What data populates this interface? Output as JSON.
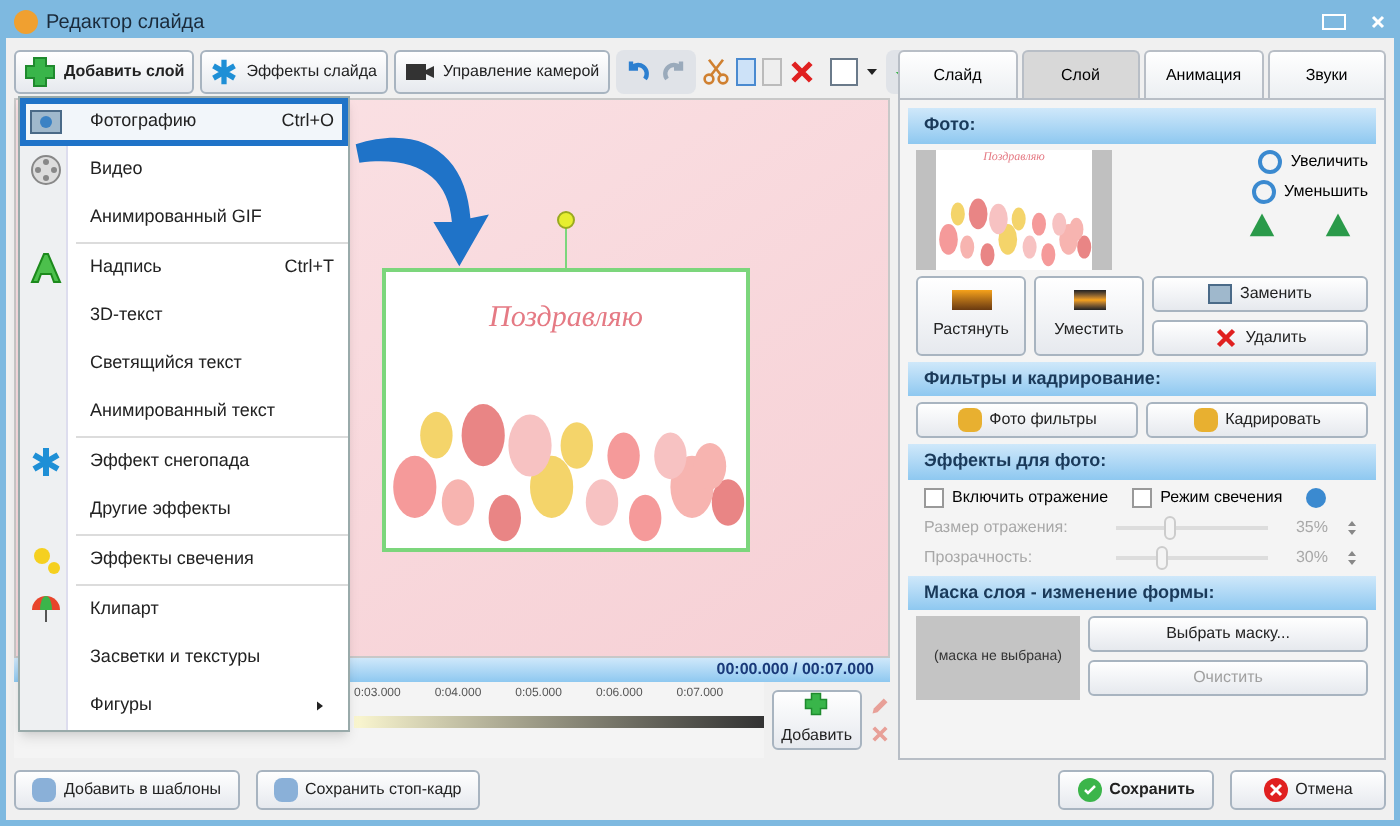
{
  "window": {
    "title": "Редактор слайда"
  },
  "toolbar": {
    "buttons": [
      {
        "label": "Добавить слой",
        "kind": "add"
      },
      {
        "label": "Эффекты слайда",
        "kind": "effects"
      },
      {
        "label": "Управление камерой",
        "kind": "camera"
      }
    ]
  },
  "menu": {
    "sections": [
      [
        {
          "label": "Фотографию",
          "shortcut": "Ctrl+O",
          "selected": true,
          "kind": "photo"
        },
        {
          "label": "Видео",
          "selected": false,
          "kind": "video"
        },
        {
          "label": "Анимированный GIF",
          "selected": false,
          "kind": "none"
        }
      ],
      [
        {
          "label": "Надпись",
          "shortcut": "Ctrl+T",
          "selected": false,
          "kind": "text"
        },
        {
          "label": "3D-текст",
          "selected": false,
          "kind": "none"
        },
        {
          "label": "Светящийся текст",
          "selected": false,
          "kind": "none"
        },
        {
          "label": "Анимированный текст",
          "selected": false,
          "kind": "none"
        }
      ],
      [
        {
          "label": "Эффект снегопада",
          "selected": false,
          "kind": "snow"
        },
        {
          "label": "Другие эффекты",
          "selected": false,
          "kind": "none"
        }
      ],
      [
        {
          "label": "Эффекты свечения",
          "selected": false,
          "kind": "glow"
        }
      ],
      [
        {
          "label": "Клипарт",
          "selected": false,
          "kind": "clipart"
        },
        {
          "label": "Засветки и текстуры",
          "selected": false,
          "kind": "none"
        },
        {
          "label": "Фигуры",
          "selected": false,
          "kind": "none",
          "submenu": true
        }
      ]
    ]
  },
  "slide": {
    "caption": "Поздравляю"
  },
  "timeline": {
    "time": "00:00.000 / 00:07.000",
    "ticks": [
      "0:03.000",
      "0:04.000",
      "0:05.000",
      "0:06.000",
      "0:07.000"
    ],
    "add_button": "Добавить"
  },
  "tabs": [
    {
      "label": "Слайд",
      "selected": false
    },
    {
      "label": "Слой",
      "selected": true
    },
    {
      "label": "Анимация",
      "selected": false
    },
    {
      "label": "Звуки",
      "selected": false
    }
  ],
  "photo": {
    "heading": "Фото:",
    "caption": "Поздравляю",
    "zoom_in": "Увеличить",
    "zoom_out": "Уменьшить",
    "stretch": "Растянуть",
    "fit": "Уместить",
    "replace": "Заменить",
    "delete": "Удалить"
  },
  "filters": {
    "heading": "Фильтры и кадрирование:",
    "buttons": [
      "Фото фильтры",
      "Кадрировать"
    ]
  },
  "effects": {
    "heading": "Эффекты для фото:",
    "checkboxes": [
      {
        "label": "Включить отражение",
        "checked": false
      },
      {
        "label": "Режим свечения",
        "checked": false
      }
    ],
    "sliders": [
      {
        "label": "Размер отражения:",
        "level": 0.35,
        "reading": "35%",
        "disabled": true
      },
      {
        "label": "Прозрачность:",
        "level": 0.3,
        "reading": "30%",
        "disabled": true
      }
    ]
  },
  "mask": {
    "heading": "Маска слоя - изменение формы:",
    "preview": "(маска не выбрана)",
    "choose": "Выбрать маску...",
    "clear": "Очистить",
    "clear_disabled": true
  },
  "bottom": {
    "left": [
      "Добавить в шаблоны",
      "Сохранить стоп-кадр"
    ],
    "save": "Сохранить",
    "cancel": "Отмена"
  }
}
